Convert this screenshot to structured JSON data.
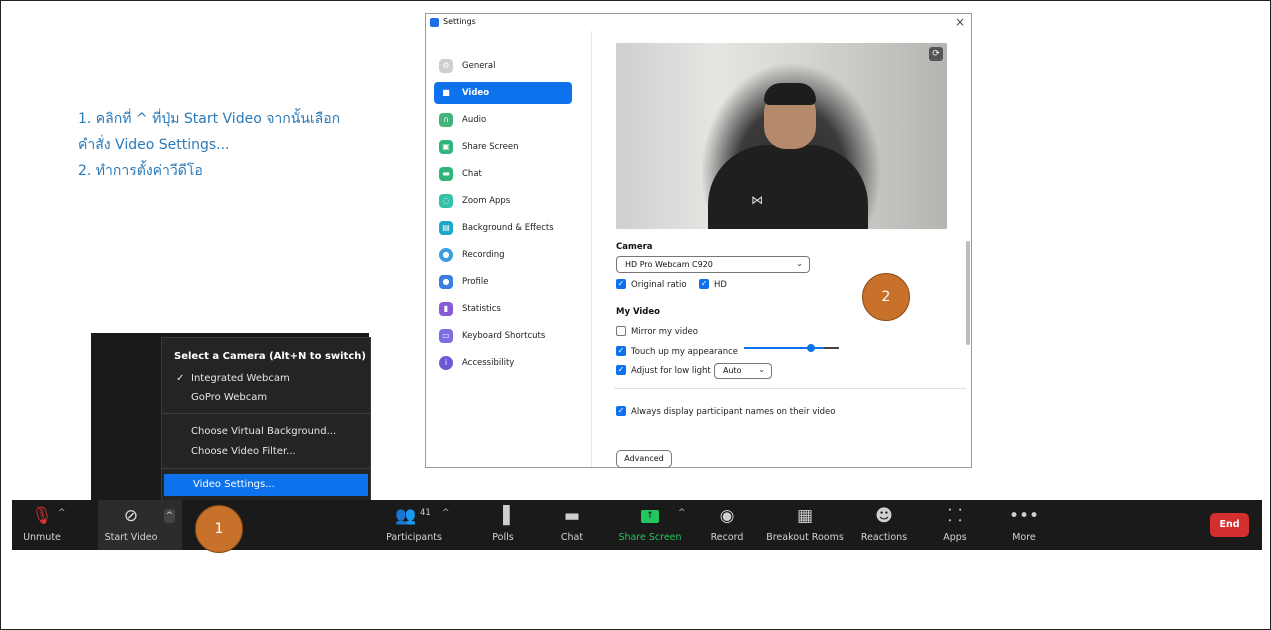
{
  "instructions": {
    "line1": "1. คลิกที่ ^ ที่ปุ่ม Start Video จากนั้นเลือก",
    "line2": "คำสั่ง Video Settings...",
    "line3": "2. ทำการตั้งค่าวีดีโอ"
  },
  "settings": {
    "title": "Settings",
    "close": "×",
    "nav": [
      {
        "label": "General",
        "icon": "gear-icon",
        "color": "#cfcfcf"
      },
      {
        "label": "Video",
        "icon": "video-camera-icon",
        "color": "#ffffff"
      },
      {
        "label": "Audio",
        "icon": "headphones-icon",
        "color": "#43b37a"
      },
      {
        "label": "Share Screen",
        "icon": "share-screen-icon",
        "color": "#2fb47c"
      },
      {
        "label": "Chat",
        "icon": "chat-icon",
        "color": "#2fb47c"
      },
      {
        "label": "Zoom Apps",
        "icon": "apps-icon",
        "color": "#35c1a8"
      },
      {
        "label": "Background & Effects",
        "icon": "background-icon",
        "color": "#1fa7c9"
      },
      {
        "label": "Recording",
        "icon": "record-icon",
        "color": "#3b9ce0"
      },
      {
        "label": "Profile",
        "icon": "profile-icon",
        "color": "#3b7de0"
      },
      {
        "label": "Statistics",
        "icon": "statistics-icon",
        "color": "#8a5ad6"
      },
      {
        "label": "Keyboard Shortcuts",
        "icon": "keyboard-icon",
        "color": "#7a6ee0"
      },
      {
        "label": "Accessibility",
        "icon": "accessibility-icon",
        "color": "#6f57d6"
      }
    ],
    "camera_label": "Camera",
    "camera_value": "HD Pro Webcam C920",
    "original_ratio": "Original ratio",
    "hd": "HD",
    "my_video": "My Video",
    "mirror": "Mirror my video",
    "touch_up": "Touch up my appearance",
    "touch_up_level": 0.7,
    "low_light": "Adjust for low light",
    "low_light_value": "Auto",
    "always_display": "Always display participant names on their video",
    "advanced": "Advanced"
  },
  "camera_menu": {
    "header": "Select a Camera (Alt+N to switch)",
    "check": "✓",
    "items": [
      "Integrated Webcam",
      "GoPro Webcam"
    ],
    "options": [
      "Choose Virtual Background...",
      "Choose Video Filter..."
    ],
    "video_settings": "Video Settings..."
  },
  "toolbar": {
    "unmute": "Unmute",
    "start_video": "Start Video",
    "participants": "Participants",
    "participant_count": "41",
    "polls": "Polls",
    "chat": "Chat",
    "share_screen": "Share Screen",
    "record": "Record",
    "breakout": "Breakout Rooms",
    "reactions": "Reactions",
    "apps": "Apps",
    "more": "More",
    "end": "End",
    "caret": "^",
    "share_color": "#22c55e",
    "end_color": "#d32f2f"
  },
  "markers": {
    "one": "1",
    "two": "2"
  }
}
